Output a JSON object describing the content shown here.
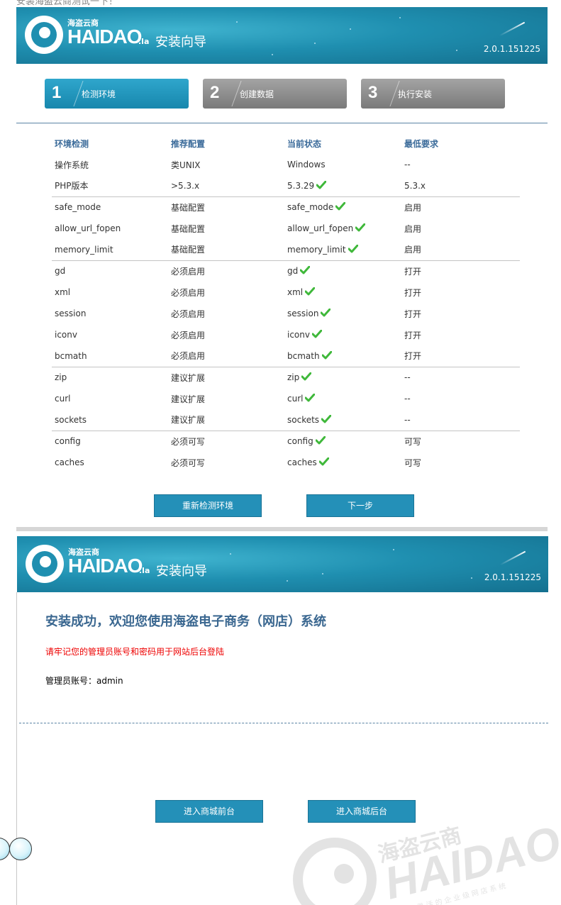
{
  "top_caption": "安装海盗云商测试一下！",
  "header": {
    "logo_cn": "海盗云商",
    "logo_en": "HAIDAO",
    "logo_suffix": ".la",
    "wizard_title": "安装向导",
    "version": "2.0.1.151225"
  },
  "steps": [
    {
      "num": "1",
      "label": "检测环境",
      "active": true
    },
    {
      "num": "2",
      "label": "创建数据",
      "active": false
    },
    {
      "num": "3",
      "label": "执行安装",
      "active": false
    }
  ],
  "env_table": {
    "headers": [
      "环境检测",
      "推荐配置",
      "当前状态",
      "最低要求"
    ],
    "rows": [
      {
        "name": "操作系统",
        "recommend": "类UNIX",
        "status": "Windows",
        "min": "--",
        "ok": false,
        "sep": false
      },
      {
        "name": "PHP版本",
        "recommend": ">5.3.x",
        "status": "5.3.29",
        "min": "5.3.x",
        "ok": true,
        "sep": false
      },
      {
        "name": "safe_mode",
        "recommend": "基础配置",
        "status": "safe_mode",
        "min": "启用",
        "ok": true,
        "sep": true
      },
      {
        "name": "allow_url_fopen",
        "recommend": "基础配置",
        "status": "allow_url_fopen",
        "min": "启用",
        "ok": true,
        "sep": false
      },
      {
        "name": "memory_limit",
        "recommend": "基础配置",
        "status": "memory_limit",
        "min": "启用",
        "ok": true,
        "sep": false
      },
      {
        "name": "gd",
        "recommend": "必须启用",
        "status": "gd",
        "min": "打开",
        "ok": true,
        "sep": true
      },
      {
        "name": "xml",
        "recommend": "必须启用",
        "status": "xml",
        "min": "打开",
        "ok": true,
        "sep": false
      },
      {
        "name": "session",
        "recommend": "必须启用",
        "status": "session",
        "min": "打开",
        "ok": true,
        "sep": false
      },
      {
        "name": "iconv",
        "recommend": "必须启用",
        "status": "iconv",
        "min": "打开",
        "ok": true,
        "sep": false
      },
      {
        "name": "bcmath",
        "recommend": "必须启用",
        "status": "bcmath",
        "min": "打开",
        "ok": true,
        "sep": false
      },
      {
        "name": "zip",
        "recommend": "建议扩展",
        "status": "zip",
        "min": "--",
        "ok": true,
        "sep": true
      },
      {
        "name": "curl",
        "recommend": "建议扩展",
        "status": "curl",
        "min": "--",
        "ok": true,
        "sep": false
      },
      {
        "name": "sockets",
        "recommend": "建议扩展",
        "status": "sockets",
        "min": "--",
        "ok": true,
        "sep": false
      },
      {
        "name": "config",
        "recommend": "必须可写",
        "status": "config",
        "min": "可写",
        "ok": true,
        "sep": true
      },
      {
        "name": "caches",
        "recommend": "必须可写",
        "status": "caches",
        "min": "可写",
        "ok": true,
        "sep": false
      }
    ]
  },
  "buttons": {
    "recheck": "重新检测环境",
    "next": "下一步",
    "front": "进入商城前台",
    "back": "进入商城后台"
  },
  "success": {
    "title": "安装成功，欢迎您使用海盗电子商务（网店）系统",
    "warning": "请牢记您的管理员账号和密码用于网站后台登陆",
    "admin_label": "管理员账号：",
    "admin_value": "admin"
  },
  "watermark": {
    "cn": "海盗云商",
    "en": "HAIDAO.",
    "tagline": "最 灵 活 的 企 业 级 网 店 系 统"
  },
  "colors": {
    "banner": "#1f8fb0",
    "step_active": "#1f97c0",
    "step_inactive": "#8e8e8e",
    "button": "#2490b8",
    "heading": "#3a6790",
    "check": "#3fb83a",
    "warning": "#e00000"
  }
}
